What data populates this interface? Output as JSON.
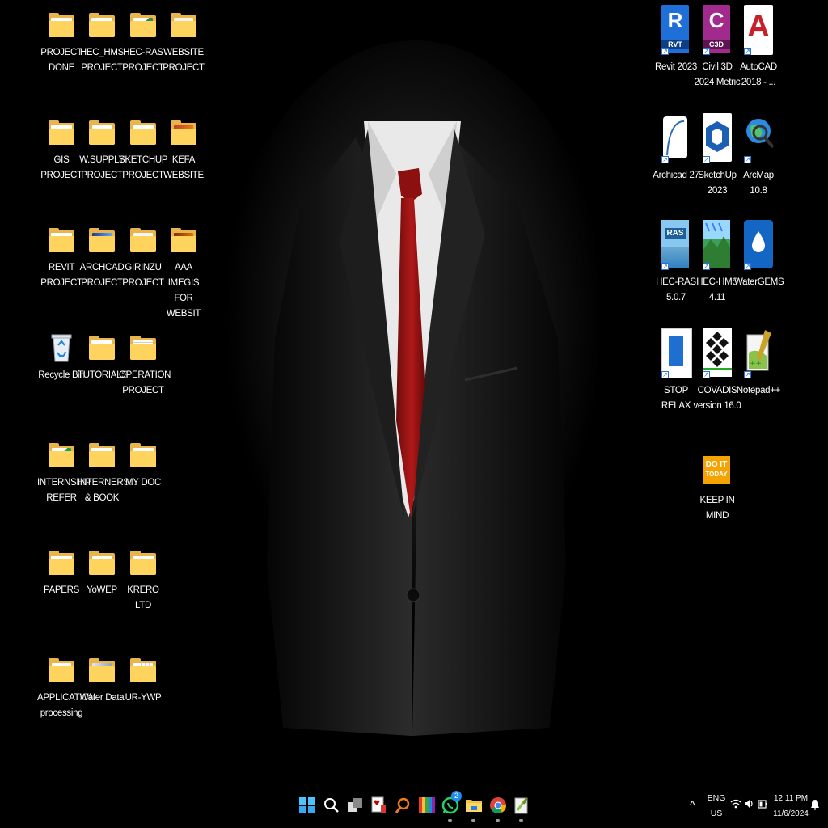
{
  "desktop": {
    "left_icons": [
      {
        "label": "PROJECT DONE",
        "type": "folder"
      },
      {
        "label": "HEC_HMS PROJECT",
        "type": "folder"
      },
      {
        "label": "HEC-RAS PROJECT",
        "type": "folder"
      },
      {
        "label": "WEBSITE PROJECT",
        "type": "folder"
      },
      {
        "label": "GIS PROJECT",
        "type": "folder"
      },
      {
        "label": "W.SUPPLY PROJECT",
        "type": "folder"
      },
      {
        "label": "SKETCHUP PROJECT",
        "type": "folder"
      },
      {
        "label": "KEFA WEBSITE",
        "type": "folder"
      },
      {
        "label": "REVIT PROJECT",
        "type": "folder"
      },
      {
        "label": "ARCHCAD PROJECT",
        "type": "folder"
      },
      {
        "label": "GIRINZU PROJECT",
        "type": "folder"
      },
      {
        "label": "AAA IMEGIS FOR WEBSIT",
        "type": "folder"
      },
      {
        "label": "Recycle Bin",
        "type": "recycle-bin"
      },
      {
        "label": "TUTORIALS",
        "type": "folder"
      },
      {
        "label": "OPERATION PROJECT",
        "type": "folder"
      },
      {
        "label": "INTERNSHIP REFER",
        "type": "folder"
      },
      {
        "label": "INTERNERS... & BOOK",
        "type": "folder"
      },
      {
        "label": "MY DOC",
        "type": "folder"
      },
      {
        "label": "PAPERS",
        "type": "folder"
      },
      {
        "label": "YoWEP",
        "type": "folder"
      },
      {
        "label": "KRERO LTD",
        "type": "folder"
      },
      {
        "label": "APPLICATION processing",
        "type": "folder"
      },
      {
        "label": "Water Data",
        "type": "folder"
      },
      {
        "label": "UR-YWP",
        "type": "folder"
      }
    ],
    "right_icons": [
      {
        "label": "Revit 2023",
        "icon": "revit-icon",
        "badge": "R",
        "sub": "RVT",
        "color": "#1f6fd9"
      },
      {
        "label": "Civil 3D 2024 Metric",
        "icon": "civil3d-icon",
        "badge": "C",
        "sub": "C3D",
        "color": "#a22a8d"
      },
      {
        "label": "AutoCAD 2018 - ...",
        "icon": "autocad-icon",
        "badge": "A",
        "sub": "",
        "color": "#c8202b"
      },
      {
        "label": "Archicad 27",
        "icon": "archicad-icon",
        "badge": "",
        "sub": "",
        "color": "#ffffff"
      },
      {
        "label": "SketchUp 2023",
        "icon": "sketchup-icon",
        "badge": "",
        "sub": "",
        "color": "#1a5fb4"
      },
      {
        "label": "ArcMap 10.8",
        "icon": "arcmap-icon",
        "badge": "",
        "sub": "",
        "color": "#2b8be0"
      },
      {
        "label": "HEC-RAS 5.0.7",
        "icon": "hec-ras-icon",
        "badge": "RAS",
        "sub": "",
        "color": "#2f7fbf"
      },
      {
        "label": "HEC-HMS 4.11",
        "icon": "hec-hms-icon",
        "badge": "",
        "sub": "",
        "color": "#3aa05a"
      },
      {
        "label": "WaterGEMS",
        "icon": "watergems-icon",
        "badge": "",
        "sub": "",
        "color": "#1466c4"
      },
      {
        "label": "STOP RELAX",
        "icon": "stop-relax-icon",
        "badge": "",
        "sub": "",
        "color": "#ffffff"
      },
      {
        "label": "COVADIS version 16.0",
        "icon": "covadis-icon",
        "badge": "",
        "sub": "",
        "color": "#ffffff"
      },
      {
        "label": "Notepad++",
        "icon": "notepadpp-icon",
        "badge": "",
        "sub": "",
        "color": "#8bc34a"
      },
      {
        "label": "KEEP IN MIND",
        "icon": "do-it-today-icon",
        "badge": "DO IT TODAY",
        "sub": "",
        "color": "#f5a300"
      }
    ]
  },
  "taskbar": {
    "apps": [
      "start-icon",
      "search-icon",
      "task-view-icon",
      "solitaire-icon",
      "magnifier-icon",
      "colorful-app-icon",
      "whatsapp-icon",
      "file-explorer-icon",
      "chrome-icon",
      "notepadpp-taskbar-icon"
    ],
    "whatsapp_badge": "2",
    "language_top": "ENG",
    "language_bottom": "US",
    "time": "12:11 PM",
    "date": "11/6/2024"
  }
}
